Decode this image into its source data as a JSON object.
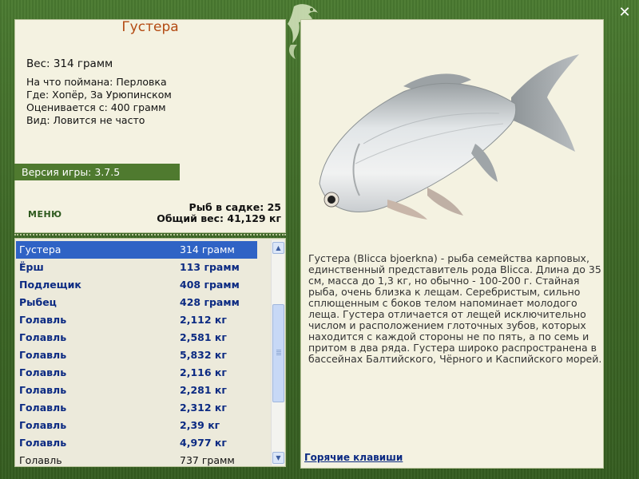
{
  "fish": {
    "name": "Густера",
    "weight_line": "Вес: 314 грамм",
    "bait_line": "На что поймана: Перловка",
    "place_line": "Где: Хопёр, За Урюпинском",
    "value_line": "Оценивается с: 400 грамм",
    "kind_line": "Вид: Ловится не часто"
  },
  "version": "Версия игры: 3.7.5",
  "menu_label": "МЕНЮ",
  "stats": {
    "count_line": "Рыб в садке: 25",
    "total_line": "Общий вес: 41,129 кг"
  },
  "catch_list": [
    {
      "name": "Густера",
      "weight": "314 грамм"
    },
    {
      "name": "Ёрш",
      "weight": "113 грамм"
    },
    {
      "name": "Подлещик",
      "weight": "408 грамм"
    },
    {
      "name": "Рыбец",
      "weight": "428 грамм"
    },
    {
      "name": "Голавль",
      "weight": "2,112 кг"
    },
    {
      "name": "Голавль",
      "weight": "2,581 кг"
    },
    {
      "name": "Голавль",
      "weight": "5,832 кг"
    },
    {
      "name": "Голавль",
      "weight": "2,116 кг"
    },
    {
      "name": "Голавль",
      "weight": "2,281 кг"
    },
    {
      "name": "Голавль",
      "weight": "2,312 кг"
    },
    {
      "name": "Голавль",
      "weight": "2,39 кг"
    },
    {
      "name": "Голавль",
      "weight": "4,977 кг"
    },
    {
      "name": "Голавль",
      "weight": "737 грамм"
    }
  ],
  "description": "Густера (Blicca bjoerkna) - рыба семейства карповых, единственный представитель рода Blicca. Длина до 35 см, масса до 1,3 кг, но обычно - 100-200 г. Стайная рыба, очень близка к лещам. Серебристым, сильно сплющенным с боков телом напоминает молодого леща. Густера отличается от лещей исключительно числом и расположением глоточных зубов, которых находится с каждой стороны не по пять, а по семь и притом в два ряда. Густера широко распространена в бассейнах Балтийского, Чёрного и Каспийского морей.",
  "hotkeys_label": "Горячие клавиши",
  "close_glyph": "✕",
  "colors": {
    "frame": "#3f6a28",
    "panel": "#f4f2e1",
    "title": "#b34a12",
    "selected_row": "#2f63c5",
    "list_text": "#0b2a82"
  }
}
